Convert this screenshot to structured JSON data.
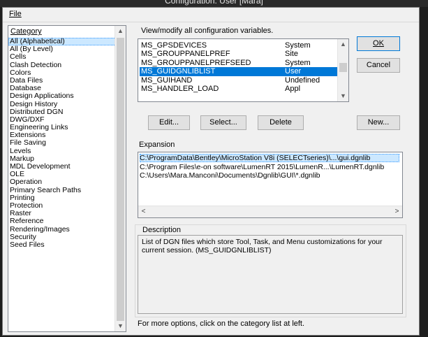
{
  "window": {
    "title": "Configuration: User [Mara]"
  },
  "menubar": {
    "file": "File"
  },
  "category": {
    "header": "Category",
    "items": [
      "All (Alphabetical)",
      "All (By Level)",
      "Cells",
      "Clash Detection",
      "Colors",
      "Data Files",
      "Database",
      "Design Applications",
      "Design History",
      "Distributed DGN",
      "DWG/DXF",
      "Engineering Links",
      "Extensions",
      "File Saving",
      "Levels",
      "Markup",
      "MDL Development",
      "OLE",
      "Operation",
      "Primary Search Paths",
      "Printing",
      "Protection",
      "Raster",
      "Reference",
      "Rendering/Images",
      "Security",
      "Seed Files"
    ],
    "selected_index": 0
  },
  "variables": {
    "heading": "View/modify all configuration variables.",
    "rows": [
      {
        "name": "MS_GPSDEVICES",
        "level": "System"
      },
      {
        "name": "MS_GROUPPANELPREF",
        "level": "Site"
      },
      {
        "name": "MS_GROUPPANELPREFSEED",
        "level": "System"
      },
      {
        "name": "MS_GUIDGNLIBLIST",
        "level": "User"
      },
      {
        "name": "MS_GUIHAND",
        "level": "Undefined"
      },
      {
        "name": "MS_HANDLER_LOAD",
        "level": "Appl"
      }
    ],
    "selected_index": 3
  },
  "buttons": {
    "ok": "OK",
    "cancel": "Cancel",
    "edit": "Edit...",
    "select": "Select...",
    "delete": "Delete",
    "new": "New..."
  },
  "expansion": {
    "label": "Expansion",
    "rows": [
      "C:\\ProgramData\\Bentley\\MicroStation V8i (SELECTseries)\\...\\gui.dgnlib",
      "C:\\Program Files\\e-on software\\LumenRT 2015\\LumenR...\\LumenRT.dgnlib",
      "C:\\Users\\Mara.Manconi\\Documents\\Dgnlib\\GUI\\*.dgnlib"
    ]
  },
  "description": {
    "label": "Description",
    "text": "List of DGN files which store Tool, Task, and Menu customizations for your current session.  (MS_GUIDGNLIBLIST)"
  },
  "footer": {
    "hint": "For more options, click on the category list at left."
  }
}
